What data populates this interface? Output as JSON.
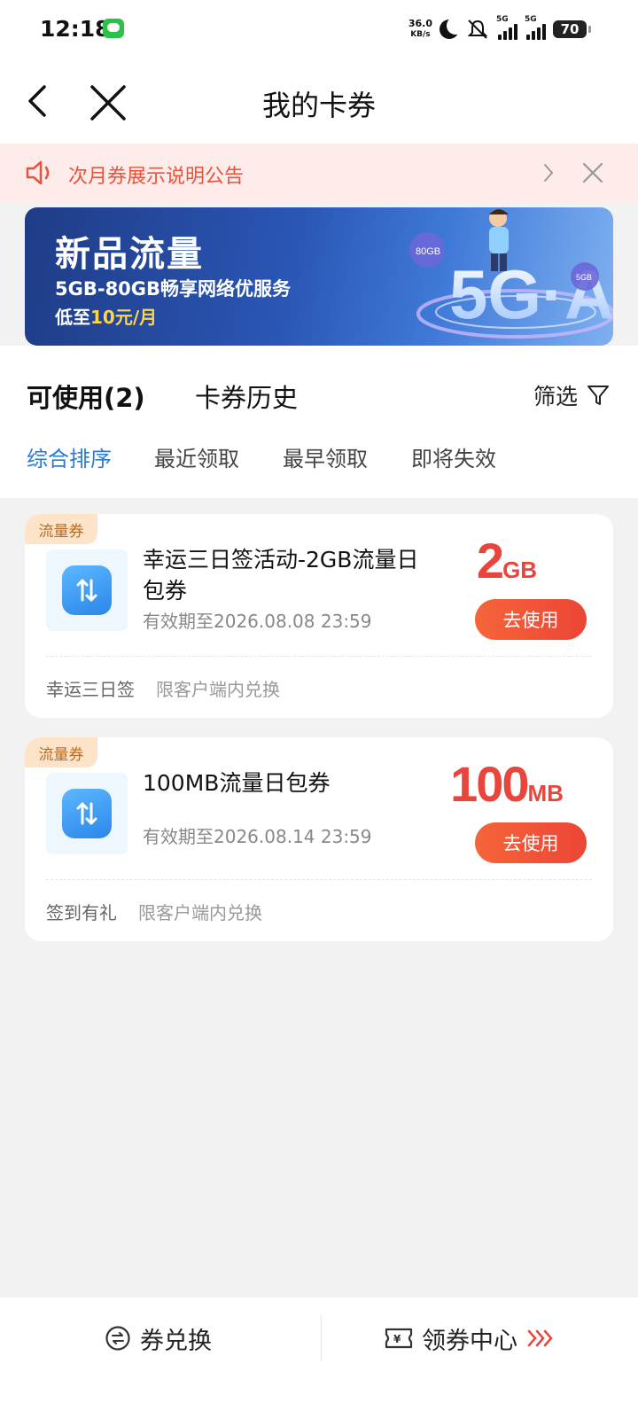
{
  "status_bar": {
    "time": "12:18",
    "net_speed_value": "36.0",
    "net_speed_unit": "KB/s",
    "net1_label": "5G",
    "net2_label": "5G",
    "battery": "70"
  },
  "header": {
    "title": "我的卡券"
  },
  "notice": {
    "text": "次月券展示说明公告"
  },
  "banner": {
    "title": "新品流量",
    "subtitle": "5GB-80GB畅享网络优服务",
    "price_prefix": "低至",
    "price_highlight": "10元/月",
    "badge_1": "80GB",
    "badge_2": "5GB",
    "art_text": "5G·A"
  },
  "tabs": {
    "available": "可使用(2)",
    "history": "卡券历史",
    "filter": "筛选"
  },
  "sort": [
    "综合排序",
    "最近领取",
    "最早领取",
    "即将失效"
  ],
  "coupons": [
    {
      "tag": "流量券",
      "name": "幸运三日签活动-2GB流量日包券",
      "validity": "有效期至2026.08.08 23:59",
      "amount": "2",
      "unit": "GB",
      "button": "去使用",
      "source": "幸运三日签",
      "limit": "限客户端内兑换"
    },
    {
      "tag": "流量券",
      "name": "100MB流量日包券",
      "validity": "有效期至2026.08.14 23:59",
      "amount": "100",
      "unit": "MB",
      "button": "去使用",
      "source": "签到有礼",
      "limit": "限客户端内兑换"
    }
  ],
  "bottom": {
    "exchange": "券兑换",
    "center": "领券中心"
  },
  "colors": {
    "accent_red": "#e8453c",
    "notice_bg": "#fdecea",
    "active_tab": "#2b7bd6",
    "tag_bg": "#fde4c8"
  }
}
